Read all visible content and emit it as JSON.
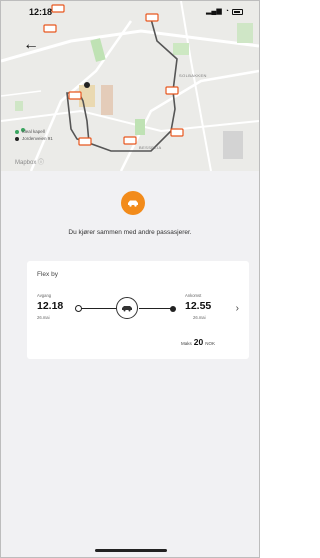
{
  "status_bar": {
    "time": "12:18",
    "location_icon": "location-arrow-icon",
    "signal_icon": "signal-icon",
    "wifi_icon": "wifi-icon",
    "battery_icon": "battery-icon"
  },
  "nav": {
    "back_icon": "back-arrow-icon"
  },
  "map": {
    "labels": [
      "SOLBAKKEN",
      "BESSELIA"
    ],
    "legend": [
      {
        "label": "Ideal kapell",
        "color": "#3aa55f"
      },
      {
        "label": "Jordenveien 91",
        "color": "#222222"
      }
    ],
    "attribution": "Mapbox"
  },
  "ride": {
    "icon": "car-icon",
    "accent_color": "#f28b1a",
    "message": "Du kjører sammen med andre passasjerer."
  },
  "card": {
    "title": "Flex by",
    "departure_label": "Avgang",
    "departure_time": "12.18",
    "departure_date": "26.mai",
    "arrival_label": "Ankomst",
    "arrival_time": "12.55",
    "arrival_date": "26.mai",
    "price_prefix": "Maks",
    "price_value": "20",
    "price_currency": "NOK",
    "chevron_icon": "chevron-right-icon"
  }
}
